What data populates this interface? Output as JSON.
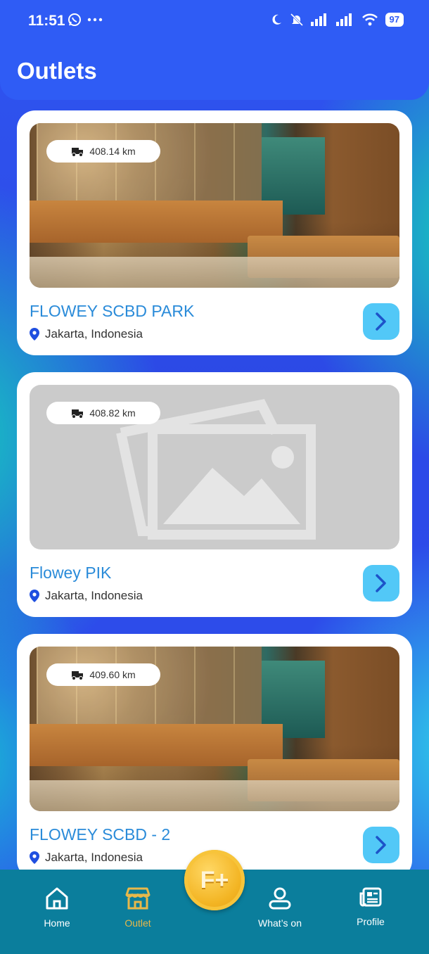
{
  "status_bar": {
    "time": "11:51",
    "battery": "97"
  },
  "header": {
    "title": "Outlets"
  },
  "outlets": [
    {
      "name": "FLOWEY SCBD PARK",
      "location": "Jakarta, Indonesia",
      "distance": "408.14 km",
      "image": "restaurant-photo"
    },
    {
      "name": "Flowey PIK",
      "location": "Jakarta, Indonesia",
      "distance": "408.82 km",
      "image": "placeholder-image"
    },
    {
      "name": "FLOWEY SCBD - 2",
      "location": "Jakarta, Indonesia",
      "distance": "409.60 km",
      "image": "restaurant-photo"
    }
  ],
  "bottom_nav": {
    "items": [
      {
        "label": "Home",
        "icon": "home-icon"
      },
      {
        "label": "Outlet",
        "icon": "store-icon",
        "active": true
      },
      {
        "label": "What’s on",
        "icon": "person-icon"
      },
      {
        "label": "Profile",
        "icon": "news-icon"
      }
    ],
    "fab": "F+"
  },
  "colors": {
    "accent": "#2f5cf5",
    "title_text": "#2a8bd9",
    "button": "#52c8f7",
    "nav_bg": "#0b7e9c",
    "nav_active": "#e8b84a"
  }
}
